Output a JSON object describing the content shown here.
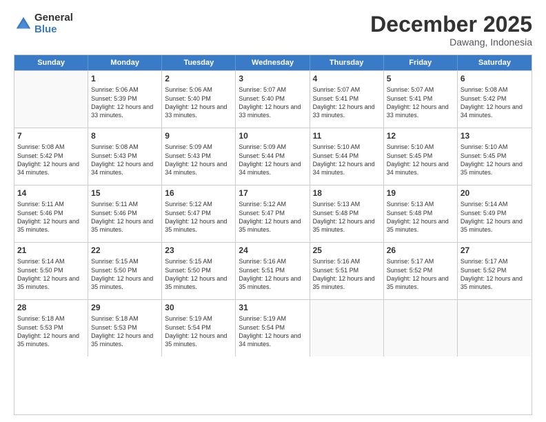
{
  "header": {
    "logo_general": "General",
    "logo_blue": "Blue",
    "month_title": "December 2025",
    "location": "Dawang, Indonesia"
  },
  "days_of_week": [
    "Sunday",
    "Monday",
    "Tuesday",
    "Wednesday",
    "Thursday",
    "Friday",
    "Saturday"
  ],
  "weeks": [
    [
      {
        "day": "",
        "empty": true
      },
      {
        "day": "1",
        "sunrise": "Sunrise: 5:06 AM",
        "sunset": "Sunset: 5:39 PM",
        "daylight": "Daylight: 12 hours and 33 minutes."
      },
      {
        "day": "2",
        "sunrise": "Sunrise: 5:06 AM",
        "sunset": "Sunset: 5:40 PM",
        "daylight": "Daylight: 12 hours and 33 minutes."
      },
      {
        "day": "3",
        "sunrise": "Sunrise: 5:07 AM",
        "sunset": "Sunset: 5:40 PM",
        "daylight": "Daylight: 12 hours and 33 minutes."
      },
      {
        "day": "4",
        "sunrise": "Sunrise: 5:07 AM",
        "sunset": "Sunset: 5:41 PM",
        "daylight": "Daylight: 12 hours and 33 minutes."
      },
      {
        "day": "5",
        "sunrise": "Sunrise: 5:07 AM",
        "sunset": "Sunset: 5:41 PM",
        "daylight": "Daylight: 12 hours and 33 minutes."
      },
      {
        "day": "6",
        "sunrise": "Sunrise: 5:08 AM",
        "sunset": "Sunset: 5:42 PM",
        "daylight": "Daylight: 12 hours and 34 minutes."
      }
    ],
    [
      {
        "day": "7",
        "sunrise": "Sunrise: 5:08 AM",
        "sunset": "Sunset: 5:42 PM",
        "daylight": "Daylight: 12 hours and 34 minutes."
      },
      {
        "day": "8",
        "sunrise": "Sunrise: 5:08 AM",
        "sunset": "Sunset: 5:43 PM",
        "daylight": "Daylight: 12 hours and 34 minutes."
      },
      {
        "day": "9",
        "sunrise": "Sunrise: 5:09 AM",
        "sunset": "Sunset: 5:43 PM",
        "daylight": "Daylight: 12 hours and 34 minutes."
      },
      {
        "day": "10",
        "sunrise": "Sunrise: 5:09 AM",
        "sunset": "Sunset: 5:44 PM",
        "daylight": "Daylight: 12 hours and 34 minutes."
      },
      {
        "day": "11",
        "sunrise": "Sunrise: 5:10 AM",
        "sunset": "Sunset: 5:44 PM",
        "daylight": "Daylight: 12 hours and 34 minutes."
      },
      {
        "day": "12",
        "sunrise": "Sunrise: 5:10 AM",
        "sunset": "Sunset: 5:45 PM",
        "daylight": "Daylight: 12 hours and 34 minutes."
      },
      {
        "day": "13",
        "sunrise": "Sunrise: 5:10 AM",
        "sunset": "Sunset: 5:45 PM",
        "daylight": "Daylight: 12 hours and 35 minutes."
      }
    ],
    [
      {
        "day": "14",
        "sunrise": "Sunrise: 5:11 AM",
        "sunset": "Sunset: 5:46 PM",
        "daylight": "Daylight: 12 hours and 35 minutes."
      },
      {
        "day": "15",
        "sunrise": "Sunrise: 5:11 AM",
        "sunset": "Sunset: 5:46 PM",
        "daylight": "Daylight: 12 hours and 35 minutes."
      },
      {
        "day": "16",
        "sunrise": "Sunrise: 5:12 AM",
        "sunset": "Sunset: 5:47 PM",
        "daylight": "Daylight: 12 hours and 35 minutes."
      },
      {
        "day": "17",
        "sunrise": "Sunrise: 5:12 AM",
        "sunset": "Sunset: 5:47 PM",
        "daylight": "Daylight: 12 hours and 35 minutes."
      },
      {
        "day": "18",
        "sunrise": "Sunrise: 5:13 AM",
        "sunset": "Sunset: 5:48 PM",
        "daylight": "Daylight: 12 hours and 35 minutes."
      },
      {
        "day": "19",
        "sunrise": "Sunrise: 5:13 AM",
        "sunset": "Sunset: 5:48 PM",
        "daylight": "Daylight: 12 hours and 35 minutes."
      },
      {
        "day": "20",
        "sunrise": "Sunrise: 5:14 AM",
        "sunset": "Sunset: 5:49 PM",
        "daylight": "Daylight: 12 hours and 35 minutes."
      }
    ],
    [
      {
        "day": "21",
        "sunrise": "Sunrise: 5:14 AM",
        "sunset": "Sunset: 5:50 PM",
        "daylight": "Daylight: 12 hours and 35 minutes."
      },
      {
        "day": "22",
        "sunrise": "Sunrise: 5:15 AM",
        "sunset": "Sunset: 5:50 PM",
        "daylight": "Daylight: 12 hours and 35 minutes."
      },
      {
        "day": "23",
        "sunrise": "Sunrise: 5:15 AM",
        "sunset": "Sunset: 5:50 PM",
        "daylight": "Daylight: 12 hours and 35 minutes."
      },
      {
        "day": "24",
        "sunrise": "Sunrise: 5:16 AM",
        "sunset": "Sunset: 5:51 PM",
        "daylight": "Daylight: 12 hours and 35 minutes."
      },
      {
        "day": "25",
        "sunrise": "Sunrise: 5:16 AM",
        "sunset": "Sunset: 5:51 PM",
        "daylight": "Daylight: 12 hours and 35 minutes."
      },
      {
        "day": "26",
        "sunrise": "Sunrise: 5:17 AM",
        "sunset": "Sunset: 5:52 PM",
        "daylight": "Daylight: 12 hours and 35 minutes."
      },
      {
        "day": "27",
        "sunrise": "Sunrise: 5:17 AM",
        "sunset": "Sunset: 5:52 PM",
        "daylight": "Daylight: 12 hours and 35 minutes."
      }
    ],
    [
      {
        "day": "28",
        "sunrise": "Sunrise: 5:18 AM",
        "sunset": "Sunset: 5:53 PM",
        "daylight": "Daylight: 12 hours and 35 minutes."
      },
      {
        "day": "29",
        "sunrise": "Sunrise: 5:18 AM",
        "sunset": "Sunset: 5:53 PM",
        "daylight": "Daylight: 12 hours and 35 minutes."
      },
      {
        "day": "30",
        "sunrise": "Sunrise: 5:19 AM",
        "sunset": "Sunset: 5:54 PM",
        "daylight": "Daylight: 12 hours and 35 minutes."
      },
      {
        "day": "31",
        "sunrise": "Sunrise: 5:19 AM",
        "sunset": "Sunset: 5:54 PM",
        "daylight": "Daylight: 12 hours and 34 minutes."
      },
      {
        "day": "",
        "empty": true
      },
      {
        "day": "",
        "empty": true
      },
      {
        "day": "",
        "empty": true
      }
    ]
  ]
}
